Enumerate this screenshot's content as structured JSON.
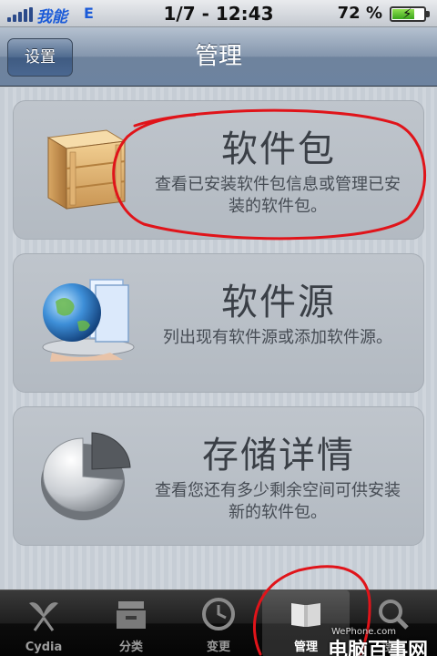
{
  "status_bar": {
    "carrier": "我能",
    "network": "E",
    "time": "1/7 - 12:43",
    "battery_percent_label": "72 %",
    "battery_level": 0.72
  },
  "nav_bar": {
    "back_label": "设置",
    "title": "管理"
  },
  "cards": [
    {
      "title": "软件包",
      "description": "查看已安装软件包信息或管理已安装的软件包。",
      "icon": "package-box-icon"
    },
    {
      "title": "软件源",
      "description": "列出现有软件源或添加软件源。",
      "icon": "globe-folder-icon"
    },
    {
      "title": "存储详情",
      "description": "查看您还有多少剩余空间可供安装新的软件包。",
      "icon": "pie-chart-icon"
    }
  ],
  "tabs": [
    {
      "label": "Cydia",
      "icon": "cydia-icon",
      "active": false
    },
    {
      "label": "分类",
      "icon": "sections-box-icon",
      "active": false
    },
    {
      "label": "变更",
      "icon": "clock-icon",
      "active": false
    },
    {
      "label": "管理",
      "icon": "book-icon",
      "active": true
    },
    {
      "label": "搜索",
      "icon": "search-icon",
      "active": false
    }
  ],
  "watermark": {
    "brand": "电脑百事网",
    "sub": "WePhone.com"
  },
  "colors": {
    "annotation_red": "#e0141a",
    "nav_blue": "#6d83a0",
    "status_blue": "#1b5bd8"
  }
}
